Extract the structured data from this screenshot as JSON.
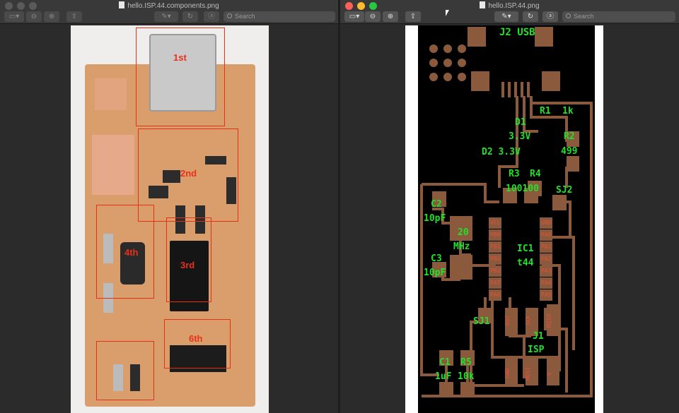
{
  "left_window": {
    "title": "hello.ISP.44.components.png",
    "search_placeholder": "Search",
    "labels": [
      "1st",
      "2nd",
      "3rd",
      "4th",
      "6th"
    ]
  },
  "right_window": {
    "title": "hello.ISP.44.png",
    "search_placeholder": "Search",
    "pcb_labels": {
      "j2": "J2 USB",
      "d1": "D1",
      "d1v": "3.3V",
      "d2": "D2 3.3V",
      "r1": "R1",
      "r1v": "1k",
      "r2": "R2",
      "r2v": "499",
      "r3": "R3",
      "r4": "R4",
      "r3r4v": "100100",
      "sj2": "SJ2",
      "c2": "C2",
      "c2v": "10pF",
      "c3": "C3",
      "c3v": "10pF",
      "xtal": "20",
      "xtalv": "MHz",
      "ic1": "IC1",
      "ic1v": "t44",
      "sj1": "SJ1",
      "j1": "J1",
      "j1v": "ISP",
      "c1": "C1",
      "c1v": "1uF",
      "r5": "R5",
      "r5v": "10k"
    },
    "pin_labels": {
      "left": [
        "VCC",
        "PB0",
        "PB1",
        "PB3",
        "PB2",
        "PA7",
        "PA6"
      ],
      "right": [
        "GND",
        "PA0",
        "PA1",
        "PA2",
        "PA3",
        "PA4",
        "PA5"
      ],
      "isp_top": [
        "RST",
        "SCK",
        "MISO"
      ],
      "isp_bottom": [
        "GND",
        "MOSI",
        "V"
      ]
    }
  },
  "colors": {
    "trace": "#8b5a3c",
    "silk": "#22e02a",
    "pad_label": "#e0523a",
    "box": "#e33216"
  }
}
